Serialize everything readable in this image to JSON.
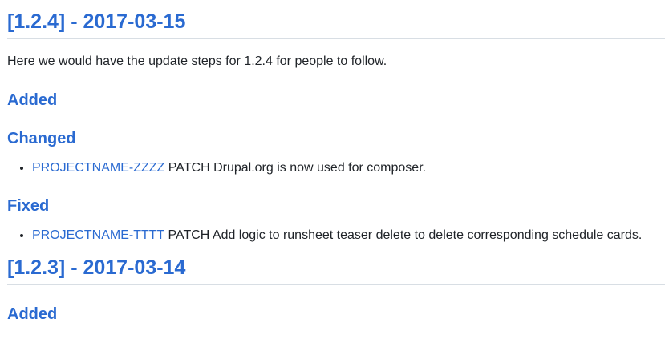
{
  "releases": [
    {
      "heading": "[1.2.4] - 2017-03-15",
      "intro": "Here we would have the update steps for 1.2.4 for people to follow.",
      "added_label": "Added",
      "changed_label": "Changed",
      "changed_items": [
        {
          "ticket": "PROJECTNAME-ZZZZ",
          "text": " PATCH Drupal.org is now used for composer."
        }
      ],
      "fixed_label": "Fixed",
      "fixed_items": [
        {
          "ticket": "PROJECTNAME-TTTT",
          "text": " PATCH Add logic to runsheet teaser delete to delete corresponding schedule cards."
        }
      ]
    },
    {
      "heading": "[1.2.3] - 2017-03-14",
      "added_label": "Added"
    }
  ],
  "colors": {
    "heading": "#2a6ad1",
    "link": "#2a6ad1",
    "text": "#1f2328",
    "divider": "#d8dee4"
  }
}
